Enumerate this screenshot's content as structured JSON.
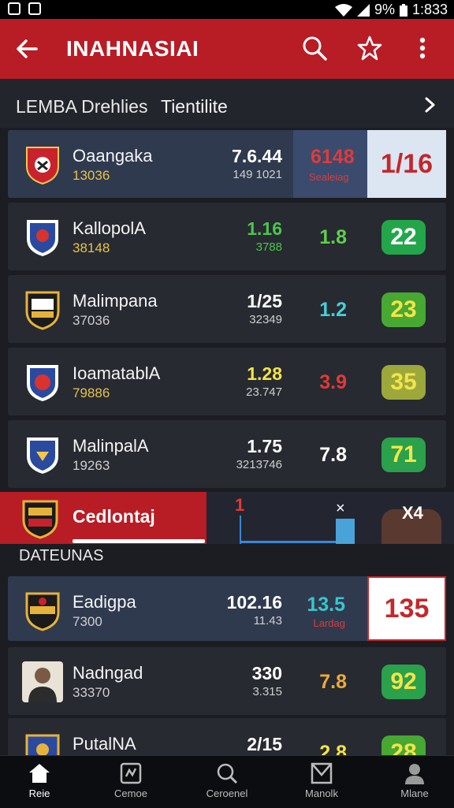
{
  "status": {
    "battery": "9%",
    "time": "1:833"
  },
  "appbar": {
    "title": "INAHNASIAI"
  },
  "tabs": {
    "left": "LEMBA Drehlies",
    "right": "Tientilite"
  },
  "rows": [
    {
      "name": "Oaangaka",
      "sub": "13036",
      "v1": "7.6.44",
      "v1_color": "#e03a3a",
      "v1s": "149 1021",
      "v2": "6148",
      "v2_color": "#e03a3a",
      "v2s": "Sealeiag",
      "badge": "1/16",
      "badge_bg": "#dbe6f2",
      "badge_color": "#c2282c"
    },
    {
      "name": "KallopolA",
      "sub": "38148",
      "v1": "1.16",
      "v1_color": "#4cc54c",
      "v1s": "3788",
      "v2": "1.8",
      "v2_color": "#5fcf4a",
      "badge": "22",
      "badge_bg": "#23a64a",
      "badge_color": "#ffffff"
    },
    {
      "name": "Malimpana",
      "sub": "37036",
      "v1": "1/25",
      "v1_color": "#ffffff",
      "v1s": "32349",
      "v2": "1.2",
      "v2_color": "#46d0d8",
      "badge": "23",
      "badge_bg": "#47a832",
      "badge_color": "#f3e44a"
    },
    {
      "name": "IoamatablA",
      "sub": "79886",
      "v1": "1.28",
      "v1_color": "#f3e44a",
      "v1s": "23.747",
      "v2": "3.9",
      "v2_color": "#e03a3a",
      "badge": "35",
      "badge_bg": "#9da83a",
      "badge_color": "#f3e44a"
    },
    {
      "name": "MalinpalA",
      "sub": "19263",
      "v1": "1.75",
      "v1_color": "#ffffff",
      "v1s": "3213746",
      "v2": "7.8",
      "v2_color": "#ffffff",
      "badge": "71",
      "badge_bg": "#2aa14a",
      "badge_color": "#f3e44a"
    }
  ],
  "promo": {
    "label": "Cedlontaj",
    "x_mark": "×",
    "x4": "X4",
    "one": "1"
  },
  "section": {
    "title": "DATEUNAS"
  },
  "rows2": [
    {
      "name": "Eadigpa",
      "sub": "7300",
      "v1": "102.16",
      "v1_color": "#ffffff",
      "v1s": "11.43",
      "v2": "13.5",
      "v2_color": "#39c6cc",
      "v2s": "Lardag",
      "badge": "135",
      "badge_bg": "#ffffff",
      "badge_color": "#c2282c"
    },
    {
      "name": "Nadngad",
      "sub": "33370",
      "v1": "330",
      "v1_color": "#ffffff",
      "v1s": "3.315",
      "v2": "7.8",
      "v2_color": "#f0a93a",
      "badge": "92",
      "badge_bg": "#2aa14a",
      "badge_color": "#f3e44a"
    },
    {
      "name": "PutalNA",
      "v1": "2/15",
      "v1_color": "#ffffff",
      "v2": "2.8",
      "v2_color": "#f3e44a",
      "badge": "28",
      "badge_bg": "#47a832",
      "badge_color": "#f3e44a"
    }
  ],
  "nav": [
    {
      "label": "Reie",
      "icon": "home-icon"
    },
    {
      "label": "Cemoe",
      "icon": "chart-icon"
    },
    {
      "label": "Ceroenel",
      "icon": "search-icon"
    },
    {
      "label": "Manolk",
      "icon": "inbox-icon"
    },
    {
      "label": "Mlane",
      "icon": "profile-icon"
    }
  ]
}
